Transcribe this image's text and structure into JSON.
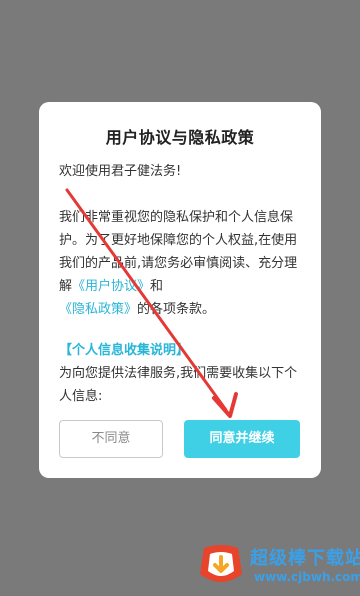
{
  "dialog": {
    "title": "用户协议与隐私政策",
    "welcome": "欢迎使用君子健法务!",
    "para_before_links": "我们非常重视您的隐私保护和个人信息保护。为了更好地保障您的个人权益,在使用我们的产品前,请您务必审慎阅读、充分理解",
    "user_agreement_link": "《用户协议》",
    "and": "和",
    "privacy_policy_link": "《隐私政策》",
    "para_after_links": "的各项条款。",
    "section_title": "【个人信息收集说明】",
    "section_body": "为向您提供法律服务,我们需要收集以下个人信息:",
    "disagree_label": "不同意",
    "agree_label": "同意并继续"
  },
  "watermark": {
    "title": "超级棒下载站",
    "url": "www.cjbwh.com"
  },
  "colors": {
    "overlay": "#7a7a7a",
    "accent": "#3fd0e6",
    "link": "#29b6d8",
    "annotation_arrow": "#e53935"
  }
}
